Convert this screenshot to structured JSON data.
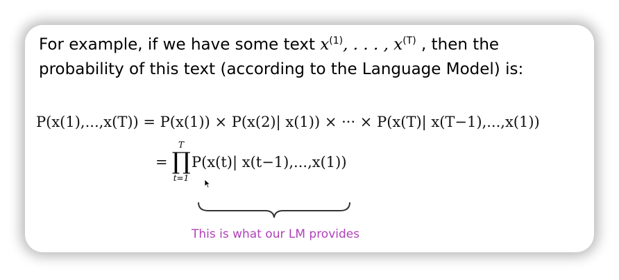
{
  "intro": {
    "line1_a": "For example, if we have some text ",
    "math_x1": "x",
    "sup1": "(1)",
    "math_dots": ", . . . , ",
    "math_xT": "x",
    "supT": "(T)",
    "line1_b": " , then the",
    "line2": "probability of this text (according to the Language Model) is:"
  },
  "equation": {
    "line1": "P(x(1),...,x(T)) = P(x(1)) × P(x(2)| x(1)) × ··· × P(x(T)| x(T−1),...,x(1))",
    "line2_eq": "=",
    "prod_upper": "T",
    "prod_symbol": "∏",
    "prod_lower": "t=1",
    "line2_rhs": "P(x(t)| x(t−1),...,x(1))"
  },
  "annotation": {
    "caption": "This is what our LM provides",
    "color": "#b040b8"
  }
}
